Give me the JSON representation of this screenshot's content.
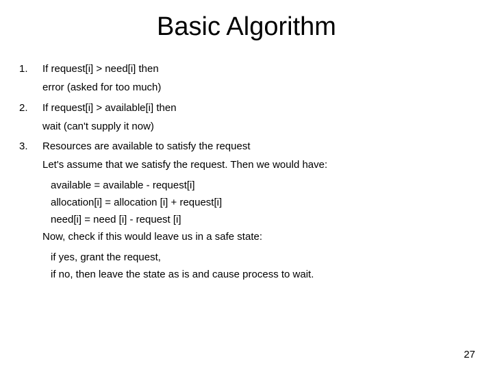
{
  "title": "Basic Algorithm",
  "items": [
    {
      "num": "1.",
      "text": "If request[i] > need[i] then",
      "subs": [
        "error (asked for too much)"
      ]
    },
    {
      "num": "2.",
      "text": "If request[i] > available[i] then",
      "subs": [
        "wait (can't supply it now)"
      ]
    },
    {
      "num": "3.",
      "text": "Resources are available to satisfy the request",
      "lines": [
        "Let's assume that we satisfy the request. Then we would have:",
        {
          "indent": true,
          "text": "available = available - request[i]"
        },
        {
          "indent": true,
          "text": "allocation[i] = allocation [i] + request[i]"
        },
        {
          "indent": true,
          "text": "need[i] = need [i] - request [i]"
        },
        "Now, check if this would leave us in a safe state:",
        {
          "indent": true,
          "text": "if yes, grant the request,"
        },
        {
          "indent": true,
          "text": "if no, then leave the state as is and cause process to wait."
        }
      ]
    }
  ],
  "pageNumber": "27"
}
